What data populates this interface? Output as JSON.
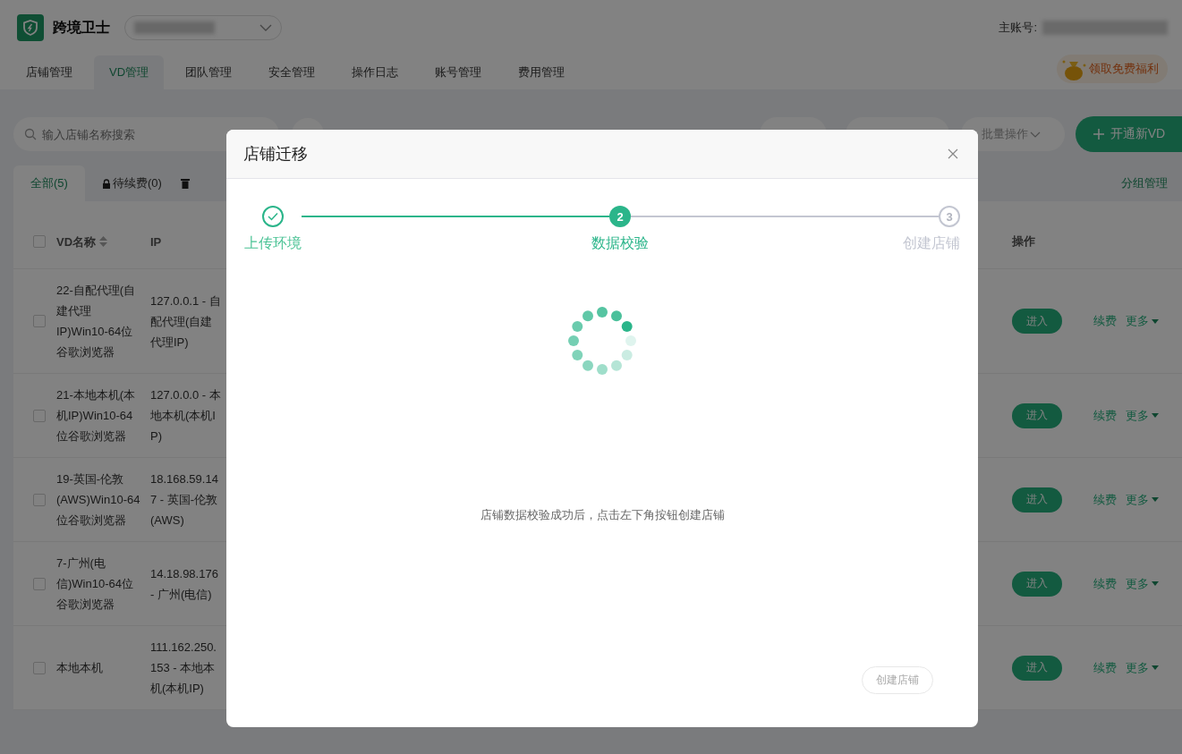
{
  "header": {
    "app_name": "跨境卫士",
    "account_label": "主账号:",
    "promo": "领取免费福利"
  },
  "nav_tabs": [
    {
      "label": "店铺管理",
      "selected": false
    },
    {
      "label": "VD管理",
      "selected": true
    },
    {
      "label": "团队管理",
      "selected": false
    },
    {
      "label": "安全管理",
      "selected": false
    },
    {
      "label": "操作日志",
      "selected": false
    },
    {
      "label": "账号管理",
      "selected": false
    },
    {
      "label": "费用管理",
      "selected": false
    }
  ],
  "toolbar": {
    "search": {
      "placeholder": "输入店铺名称搜索"
    },
    "batch": "批量操作",
    "create": "开通新VD"
  },
  "filter_tabs": [
    {
      "label": "全部(5)",
      "selected": true,
      "kind": "plain"
    },
    {
      "label": "待续费(0)",
      "selected": false,
      "kind": "lock"
    }
  ],
  "group_manage": "分组管理",
  "table": {
    "columns": [
      "VD名称",
      "IP",
      "操作"
    ],
    "all_checked": false,
    "rows": [
      {
        "checked": false,
        "name": "22-自配代理(自建代理IP)Win10-64位谷歌浏览器",
        "ip": "127.0.0.1 - 自配代理(自建代理IP)",
        "enter": "进入",
        "renew": "续费",
        "more": "更多"
      },
      {
        "checked": false,
        "name": "21-本地本机(本机IP)Win10-64位谷歌浏览器",
        "ip": "127.0.0.0 - 本地本机(本机IP)",
        "enter": "进入",
        "renew": "续费",
        "more": "更多"
      },
      {
        "checked": false,
        "name": "19-英国-伦敦(AWS)Win10-64位谷歌浏览器",
        "ip": "18.168.59.147 - 英国-伦敦(AWS)",
        "enter": "进入",
        "renew": "续费",
        "more": "更多"
      },
      {
        "checked": false,
        "name": "7-广州(电信)Win10-64位谷歌浏览器",
        "ip": "14.18.98.176 - 广州(电信)",
        "enter": "进入",
        "renew": "续费",
        "more": "更多"
      },
      {
        "checked": false,
        "name": "本地本机",
        "ip": "111.162.250.153 - 本地本机(本机IP)",
        "enter": "进入",
        "renew": "续费",
        "more": "更多"
      }
    ]
  },
  "dialog": {
    "title": "店铺迁移",
    "steps": [
      {
        "label": "上传环境",
        "done": true,
        "active": false
      },
      {
        "label": "数据校验",
        "done": false,
        "active": true,
        "number": "2"
      },
      {
        "label": "创建店铺",
        "done": false,
        "active": false,
        "number": "3"
      }
    ],
    "message": "店铺数据校验成功后，点击左下角按钮创建店铺",
    "button": {
      "label": "创建店铺",
      "disabled": true
    }
  }
}
